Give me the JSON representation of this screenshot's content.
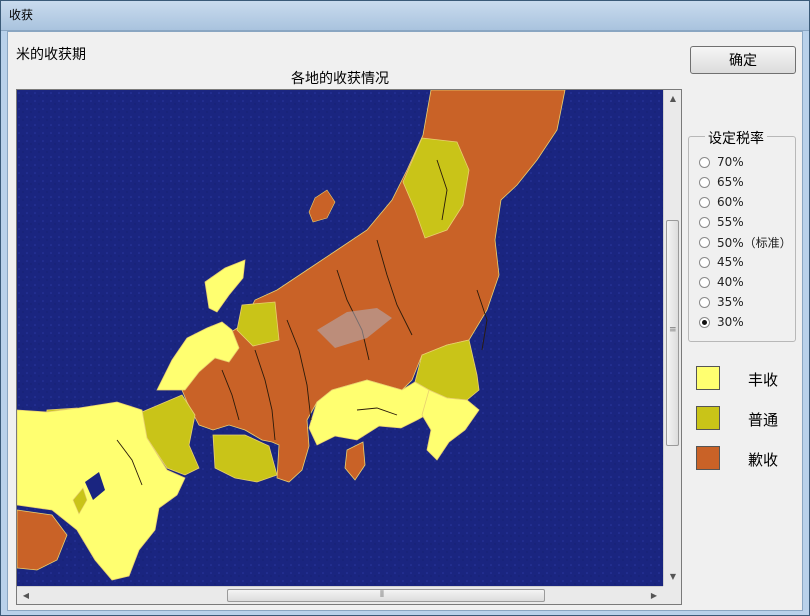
{
  "window": {
    "title": "收获"
  },
  "caption": "米的收获期",
  "map": {
    "title": "各地的收获情况"
  },
  "ok_button": "确定",
  "tax_rate": {
    "legend": "设定税率",
    "options": [
      "70%",
      "65%",
      "60%",
      "55%",
      "50%（标准）",
      "45%",
      "40%",
      "35%",
      "30%"
    ],
    "selected": "30%"
  },
  "legend": [
    {
      "label": "丰收",
      "color": "#ffff70"
    },
    {
      "label": "普通",
      "color": "#c9c418"
    },
    {
      "label": "歉收",
      "color": "#c96227"
    }
  ],
  "colors": {
    "sea": "#1a2580",
    "border": "#e8d070",
    "river": "#2a1a0a"
  }
}
